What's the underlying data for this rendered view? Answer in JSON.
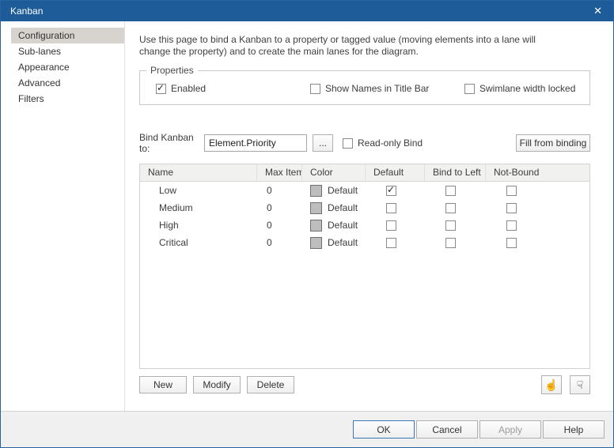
{
  "window": {
    "title": "Kanban",
    "close_glyph": "✕"
  },
  "sidebar": {
    "items": [
      {
        "label": "Configuration",
        "selected": true
      },
      {
        "label": "Sub-lanes",
        "selected": false
      },
      {
        "label": "Appearance",
        "selected": false
      },
      {
        "label": "Advanced",
        "selected": false
      },
      {
        "label": "Filters",
        "selected": false
      }
    ]
  },
  "main": {
    "description": [
      "Use this page to bind a Kanban to a property or tagged value (moving elements into a lane will",
      "change the property) and to create the main lanes for the diagram."
    ],
    "properties": {
      "title": "Properties",
      "checkboxes": [
        {
          "label": "Enabled",
          "checked": true
        },
        {
          "label": "Show Names in Title Bar",
          "checked": false
        },
        {
          "label": "Swimlane width locked",
          "checked": false
        }
      ]
    },
    "bind": {
      "label": "Bind Kanban to:",
      "value": "Element.Priority",
      "browse": "...",
      "readonly_label": "Read-only Bind",
      "readonly_checked": false,
      "fill_button": "Fill from binding"
    },
    "table": {
      "headers": [
        "Name",
        "Max Items",
        "Color",
        "Default",
        "Bind to Left",
        "Not-Bound"
      ],
      "rows": [
        {
          "name": "Low",
          "max_items": "0",
          "color_label": "Default",
          "swatch": "#bdbdbd",
          "default_checked": true,
          "bind_left_checked": false,
          "not_bound_checked": false
        },
        {
          "name": "Medium",
          "max_items": "0",
          "color_label": "Default",
          "swatch": "#bdbdbd",
          "default_checked": false,
          "bind_left_checked": false,
          "not_bound_checked": false
        },
        {
          "name": "High",
          "max_items": "0",
          "color_label": "Default",
          "swatch": "#bdbdbd",
          "default_checked": false,
          "bind_left_checked": false,
          "not_bound_checked": false
        },
        {
          "name": "Critical",
          "max_items": "0",
          "color_label": "Default",
          "swatch": "#bdbdbd",
          "default_checked": false,
          "bind_left_checked": false,
          "not_bound_checked": false
        }
      ]
    },
    "actions": {
      "new": "New",
      "modify": "Modify",
      "delete": "Delete"
    },
    "hand_icons": {
      "up": "☝",
      "down": "☟"
    }
  },
  "footer": {
    "ok": "OK",
    "cancel": "Cancel",
    "apply": "Apply",
    "help": "Help"
  },
  "colors": {
    "titlebar": "#1d5c98",
    "selected_item_bg": "#d7d4cf",
    "default_button_border": "#3a77bd",
    "swatch_default": "#bdbdbd"
  }
}
